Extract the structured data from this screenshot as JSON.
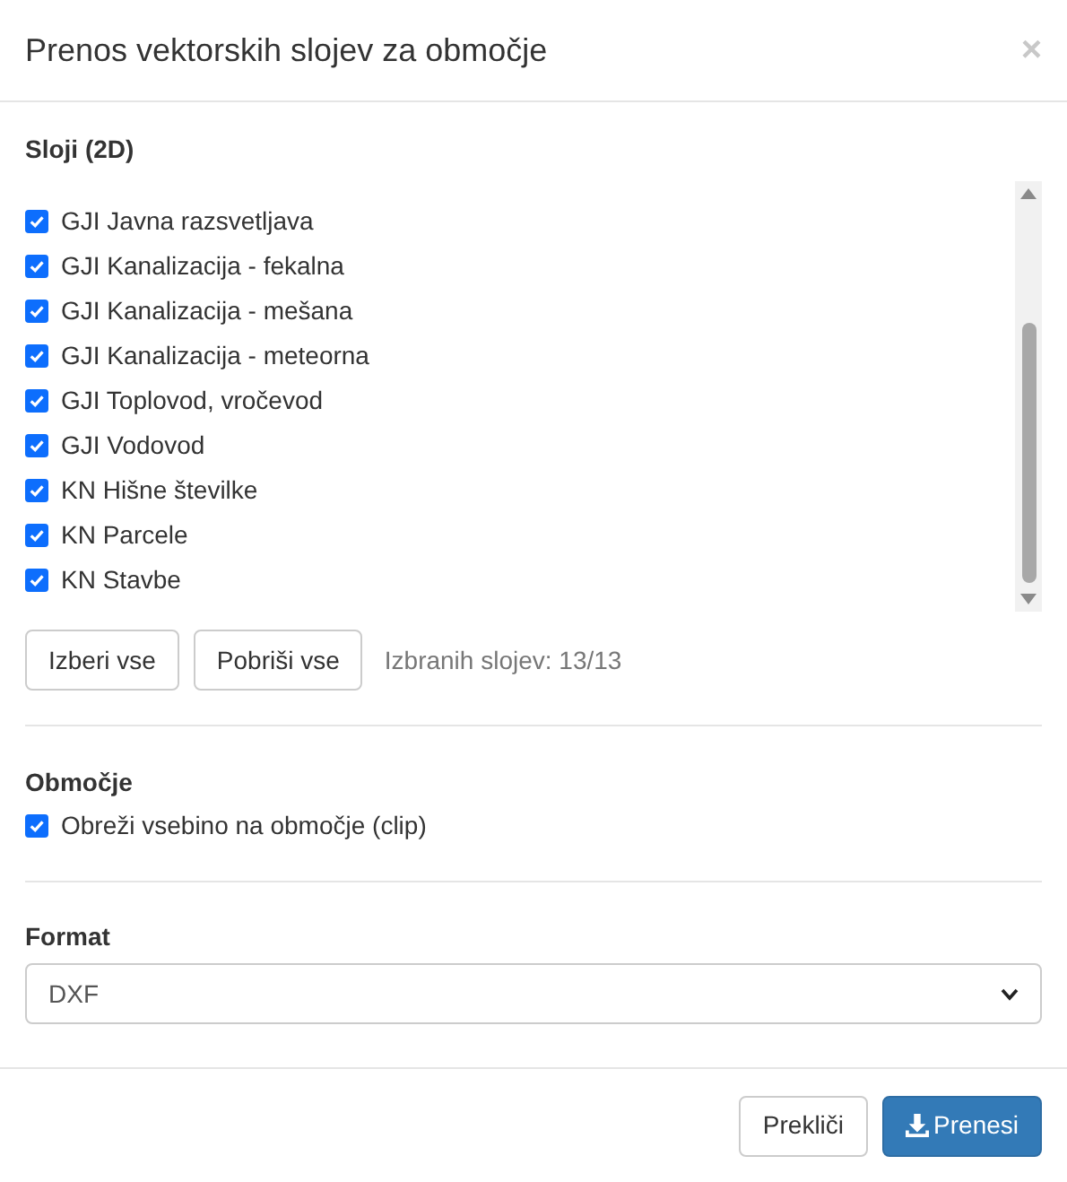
{
  "dialog": {
    "title": "Prenos vektorskih slojev za območje",
    "close": "×"
  },
  "layers": {
    "heading": "Sloji (2D)",
    "items": [
      {
        "label": "GJI Javna razsvetljava",
        "checked": true
      },
      {
        "label": "GJI Kanalizacija - fekalna",
        "checked": true
      },
      {
        "label": "GJI Kanalizacija - mešana",
        "checked": true
      },
      {
        "label": "GJI Kanalizacija - meteorna",
        "checked": true
      },
      {
        "label": "GJI Toplovod, vročevod",
        "checked": true
      },
      {
        "label": "GJI Vodovod",
        "checked": true
      },
      {
        "label": "KN Hišne številke",
        "checked": true
      },
      {
        "label": "KN Parcele",
        "checked": true
      },
      {
        "label": "KN Stavbe",
        "checked": true
      }
    ],
    "buttons": [
      "Izberi vse",
      "Pobriši vse"
    ],
    "count": "Izbranih slojev: 13/13"
  },
  "area": {
    "heading": "Območje",
    "clip": {
      "label": "Obreži vsebino na območje (clip)",
      "checked": true
    }
  },
  "format": {
    "heading": "Format",
    "value": "DXF"
  },
  "footer": {
    "cancel": "Prekliči",
    "download": "Prenesi"
  }
}
